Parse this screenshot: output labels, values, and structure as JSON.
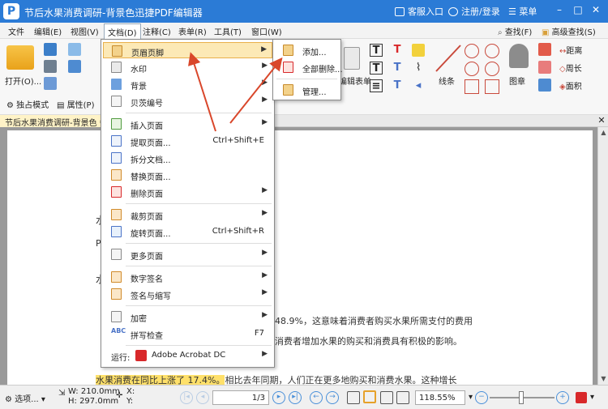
{
  "window": {
    "title": "节后水果消费调研-背景色迅捷PDF编辑器",
    "service": "客服入口",
    "login": "注册/登录",
    "menu": "菜单"
  },
  "menubar": {
    "items": [
      "文件",
      "编辑(E)",
      "视图(V)",
      "文档(D)",
      "注释(C)",
      "表单(R)",
      "工具(T)",
      "窗口(W)"
    ],
    "find": "查找(F)",
    "advanced_find": "高级查找(S)"
  },
  "toolbar": {
    "open_label": "打开(O)...",
    "exclusive_mode": "独占模式",
    "properties": "属性(P)",
    "edit_form": "编辑表单",
    "line": "线条",
    "stamp": "图章",
    "distance": "距离",
    "perimeter": "周长",
    "area": "面积"
  },
  "document_tab": {
    "title": "节后水果消费调研-背景色 *"
  },
  "document": {
    "frag_a": "水",
    "frag_p": "P",
    "frag_water": "水",
    "line1": "48.9%，这意味着消费者购买水果所需支付的费用",
    "line2": "消费者增加水果的购买和消费具有积极的影响。",
    "line3_highlight": "水果消费在同比上涨了 17.4%。",
    "line3_rest": "相比去年同期，人们正在更多地购买和消费水果。这种增长"
  },
  "doc_menu": {
    "items": [
      {
        "label": "页眉页脚",
        "submenu": true
      },
      {
        "label": "水印",
        "submenu": true
      },
      {
        "label": "背景",
        "submenu": true
      },
      {
        "label": "贝茨编号",
        "submenu": true
      },
      {
        "label": "插入页面",
        "submenu": true
      },
      {
        "label": "提取页面...",
        "shortcut": "Ctrl+Shift+E"
      },
      {
        "label": "拆分文档..."
      },
      {
        "label": "替换页面..."
      },
      {
        "label": "删除页面",
        "submenu": true
      },
      {
        "label": "裁剪页面",
        "submenu": true
      },
      {
        "label": "旋转页面...",
        "shortcut": "Ctrl+Shift+R"
      },
      {
        "label": "更多页面",
        "submenu": true
      },
      {
        "label": "数字签名",
        "submenu": true
      },
      {
        "label": "签名与缩写",
        "submenu": true
      },
      {
        "label": "加密",
        "submenu": true
      },
      {
        "label": "拼写检查",
        "shortcut": "F7"
      },
      {
        "label": "运行:",
        "app": "Adobe Acrobat DC",
        "submenu": true
      }
    ]
  },
  "header_footer_submenu": {
    "items": [
      "添加...",
      "全部删除...",
      "管理..."
    ]
  },
  "statusbar": {
    "options": "选项...",
    "width": "W: 210.0mm",
    "height": "H: 297.0mm",
    "x": "X:",
    "y": "Y:",
    "page": "1",
    "page_total": "/3",
    "zoom": "118.55%"
  },
  "colors": {
    "titlebar": "#2b7bd6",
    "highlight": "#ffe06a",
    "menu_hover": "#fce9b6",
    "arrow": "#d9472b"
  }
}
